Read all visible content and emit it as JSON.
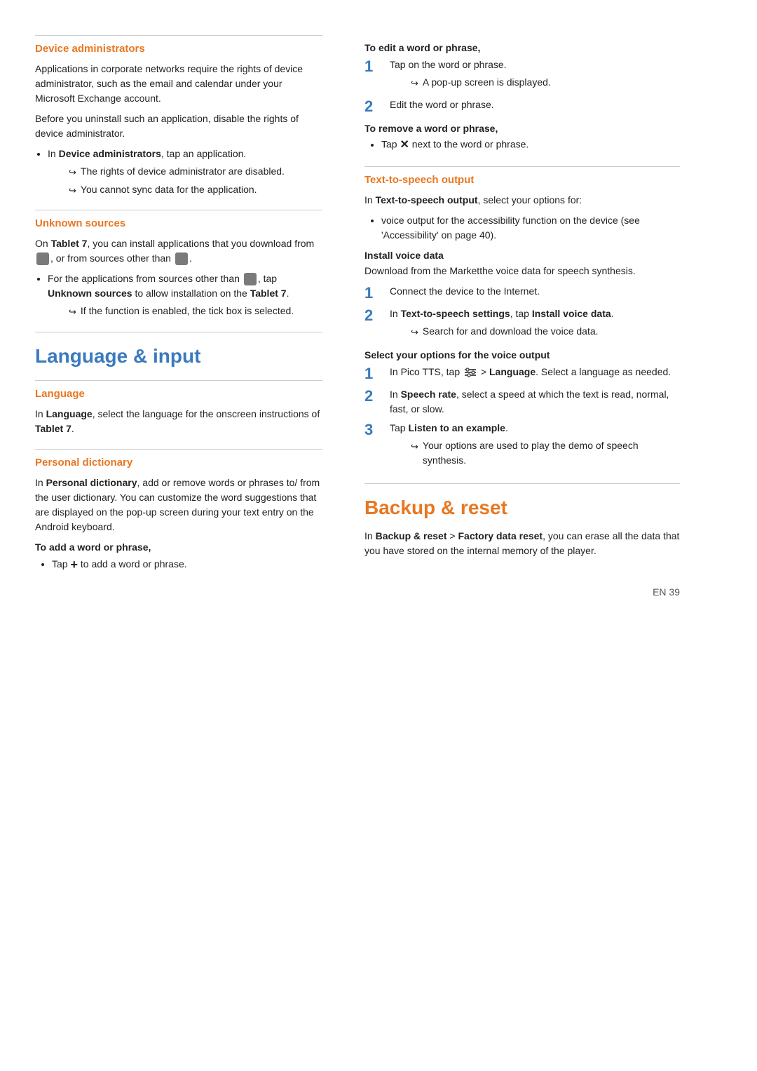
{
  "left": {
    "device_administrators": {
      "title": "Device administrators",
      "divider": true,
      "para1": "Applications in corporate networks require the rights of device administrator, such as the email and calendar under your Microsoft Exchange account.",
      "para2": "Before you uninstall such an application, disable the rights of device administrator.",
      "bullet1": "In Device administrators, tap an application.",
      "arrow1": "The rights of device administrator are disabled.",
      "arrow2": "You cannot sync data for the application."
    },
    "unknown_sources": {
      "title": "Unknown sources",
      "divider": true,
      "para1_start": "On ",
      "para1_bold": "Tablet 7",
      "para1_end": ", you can install applications that you download from",
      "para1_end2": ", or from sources other than",
      "bullet1_start": "For the applications from sources other than",
      "bullet1_end": ", tap ",
      "bullet1_bold": "Unknown sources",
      "bullet1_end2": " to allow installation on the ",
      "bullet1_bold2": "Tablet 7",
      "bullet1_end3": ".",
      "arrow1": "If the function is enabled, the tick box is selected."
    },
    "language_input": {
      "big_title": "Language & input"
    },
    "language": {
      "title": "Language",
      "divider": true,
      "para1_start": "In ",
      "para1_bold": "Language",
      "para1_end": ", select the language for the onscreen instructions of ",
      "para1_bold2": "Tablet 7",
      "para1_end2": "."
    },
    "personal_dictionary": {
      "title": "Personal dictionary",
      "divider": true,
      "para1_start": "In ",
      "para1_bold": "Personal dictionary",
      "para1_end": ", add or remove words or phrases to/ from the user dictionary. You can customize the word suggestions that are displayed on the pop-up screen during your text entry on the Android keyboard.",
      "to_add_label": "To add a word or phrase,",
      "to_add_bullet": "Tap",
      "to_add_end": "to add a word or phrase."
    }
  },
  "right": {
    "to_edit_label": "To edit a word or phrase,",
    "edit_step1": "Tap on the word or phrase.",
    "edit_arrow1": "A pop-up screen is displayed.",
    "edit_step2": "Edit the word or phrase.",
    "to_remove_label": "To remove a word or phrase,",
    "to_remove_bullet_start": "Tap",
    "to_remove_bullet_end": "next to the word or phrase.",
    "tts_output": {
      "title": "Text-to-speech output",
      "divider": true,
      "para1_start": "In ",
      "para1_bold": "Text-to-speech output",
      "para1_end": ", select your options for:",
      "bullet1": "voice output for the accessibility function on the device (see 'Accessibility' on page 40).",
      "install_label": "Install voice data",
      "install_para_start": "Download from the Market",
      "install_para_mid": "the voice data for speech synthesis.",
      "step1": "Connect the device to the Internet.",
      "step2_start": "In ",
      "step2_bold": "Text-to-speech settings",
      "step2_mid": ", tap ",
      "step2_bold2": "Install voice data",
      "step2_end": ".",
      "step2_arrow": "Search for and download the voice data.",
      "select_label": "Select your options for the voice output",
      "sel_step1_start": "In Pico TTS, tap",
      "sel_step1_end_start": "> ",
      "sel_step1_bold": "Language",
      "sel_step1_end": ". Select a language as needed.",
      "sel_step2_start": "In ",
      "sel_step2_bold": "Speech rate",
      "sel_step2_end": ", select a speed at which the text is read, normal, fast, or slow.",
      "sel_step3_start": "Tap ",
      "sel_step3_bold": "Listen to an example",
      "sel_step3_end": ".",
      "sel_step3_arrow": "Your options are used to play the demo of speech synthesis."
    },
    "backup_reset": {
      "big_title": "Backup & reset",
      "para1_start": "In ",
      "para1_bold": "Backup & reset",
      "para1_mid": " > ",
      "para1_bold2": "Factory data reset",
      "para1_end": ", you can erase all the data that you have stored on the internal memory of the player."
    }
  },
  "page_num": "EN   39"
}
